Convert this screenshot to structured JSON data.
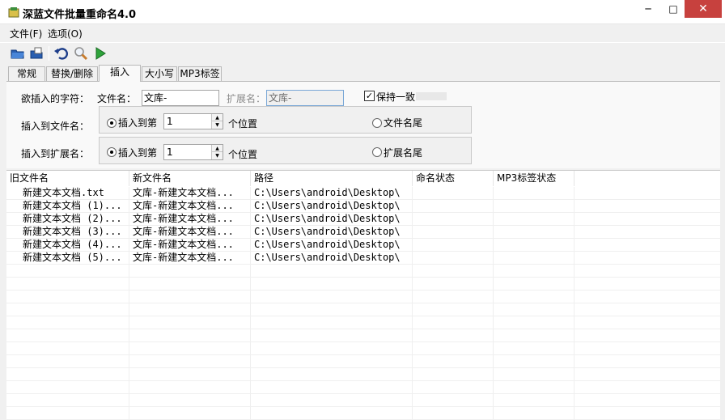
{
  "window": {
    "title": "深蓝文件批量重命名4.0",
    "min": "─",
    "max": "□",
    "close": "✕"
  },
  "menu": [
    {
      "label": "文件(F)"
    },
    {
      "label": "选项(O)"
    }
  ],
  "toolbar": {
    "icons": [
      "open-folder-icon",
      "open-file-icon",
      "undo-icon",
      "search-icon",
      "run-icon"
    ]
  },
  "tabs": [
    {
      "label": "常规"
    },
    {
      "label": "替换/删除"
    },
    {
      "label": "插入",
      "active": true
    },
    {
      "label": "大小写"
    },
    {
      "label": "MP3标签"
    }
  ],
  "insert_panel": {
    "chars_label": "欲插入的字符：",
    "filename_label": "文件名：",
    "filename_value": "文库-",
    "ext_label": "扩展名：",
    "ext_value": "文库-",
    "keep_same_label": "保持一致",
    "keep_same_checked": true,
    "insert_to_filename": {
      "label": "插入到文件名：",
      "position_option": "插入到第",
      "position_value": "1",
      "position_suffix": "个位置",
      "end_option": "文件名尾"
    },
    "insert_to_ext": {
      "label": "插入到扩展名：",
      "position_option": "插入到第",
      "position_value": "1",
      "position_suffix": "个位置",
      "end_option": "扩展名尾"
    }
  },
  "file_list": {
    "columns": [
      "旧文件名",
      "新文件名",
      "路径",
      "命名状态",
      "MP3标签状态"
    ],
    "rows": [
      {
        "old": "新建文本文档.txt",
        "new": "文库-新建文本文档...",
        "path": "C:\\Users\\android\\Desktop\\",
        "status": "",
        "mp3": ""
      },
      {
        "old": "新建文本文档 (1)...",
        "new": "文库-新建文本文档...",
        "path": "C:\\Users\\android\\Desktop\\",
        "status": "",
        "mp3": ""
      },
      {
        "old": "新建文本文档 (2)...",
        "new": "文库-新建文本文档...",
        "path": "C:\\Users\\android\\Desktop\\",
        "status": "",
        "mp3": ""
      },
      {
        "old": "新建文本文档 (3)...",
        "new": "文库-新建文本文档...",
        "path": "C:\\Users\\android\\Desktop\\",
        "status": "",
        "mp3": ""
      },
      {
        "old": "新建文本文档 (4)...",
        "new": "文库-新建文本文档...",
        "path": "C:\\Users\\android\\Desktop\\",
        "status": "",
        "mp3": ""
      },
      {
        "old": "新建文本文档 (5)...",
        "new": "文库-新建文本文档...",
        "path": "C:\\Users\\android\\Desktop\\",
        "status": "",
        "mp3": ""
      }
    ]
  }
}
